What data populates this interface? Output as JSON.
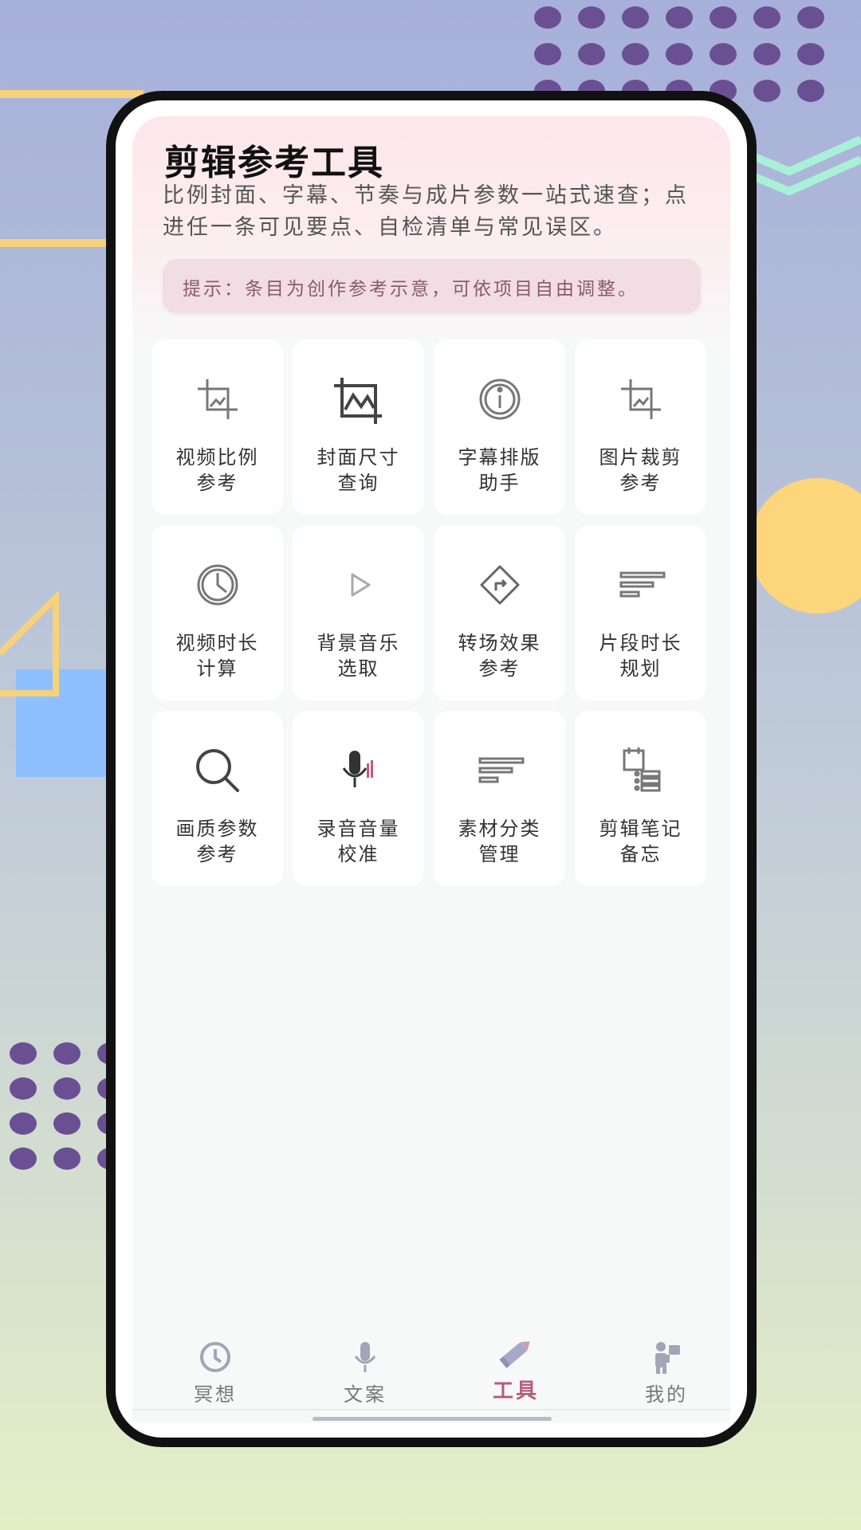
{
  "header": {
    "title": "剪辑参考工具",
    "description": "比例封面、字幕、节奏与成片参数一站式速查；点进任一条可见要点、自检清单与常见误区。",
    "tip": "提示：条目为创作参考示意，可依项目自由调整。"
  },
  "tools": [
    {
      "label": "视频比例参考",
      "icon": "crop-icon"
    },
    {
      "label": "封面尺寸查询",
      "icon": "image-frame-icon"
    },
    {
      "label": "字幕排版助手",
      "icon": "info-icon"
    },
    {
      "label": "图片裁剪参考",
      "icon": "crop-icon"
    },
    {
      "label": "视频时长计算",
      "icon": "clock-icon"
    },
    {
      "label": "背景音乐选取",
      "icon": "play-icon"
    },
    {
      "label": "转场效果参考",
      "icon": "direction-sign-icon"
    },
    {
      "label": "片段时长规划",
      "icon": "lines-icon"
    },
    {
      "label": "画质参数参考",
      "icon": "search-icon"
    },
    {
      "label": "录音音量校准",
      "icon": "microphone-icon"
    },
    {
      "label": "素材分类管理",
      "icon": "lines-icon"
    },
    {
      "label": "剪辑笔记备忘",
      "icon": "notes-list-icon"
    }
  ],
  "tabbar": {
    "tabs": [
      {
        "label": "冥想",
        "icon": "clock-icon",
        "active": false
      },
      {
        "label": "文案",
        "icon": "microphone-icon",
        "active": false
      },
      {
        "label": "工具",
        "icon": "pencil-icon",
        "active": true
      },
      {
        "label": "我的",
        "icon": "person-icon",
        "active": false
      }
    ]
  },
  "colors": {
    "accent": "#b25d7e",
    "tip_bg": "#f2dde4",
    "card_bg": "#ffffff",
    "page_bg": "#f7f8f8"
  }
}
